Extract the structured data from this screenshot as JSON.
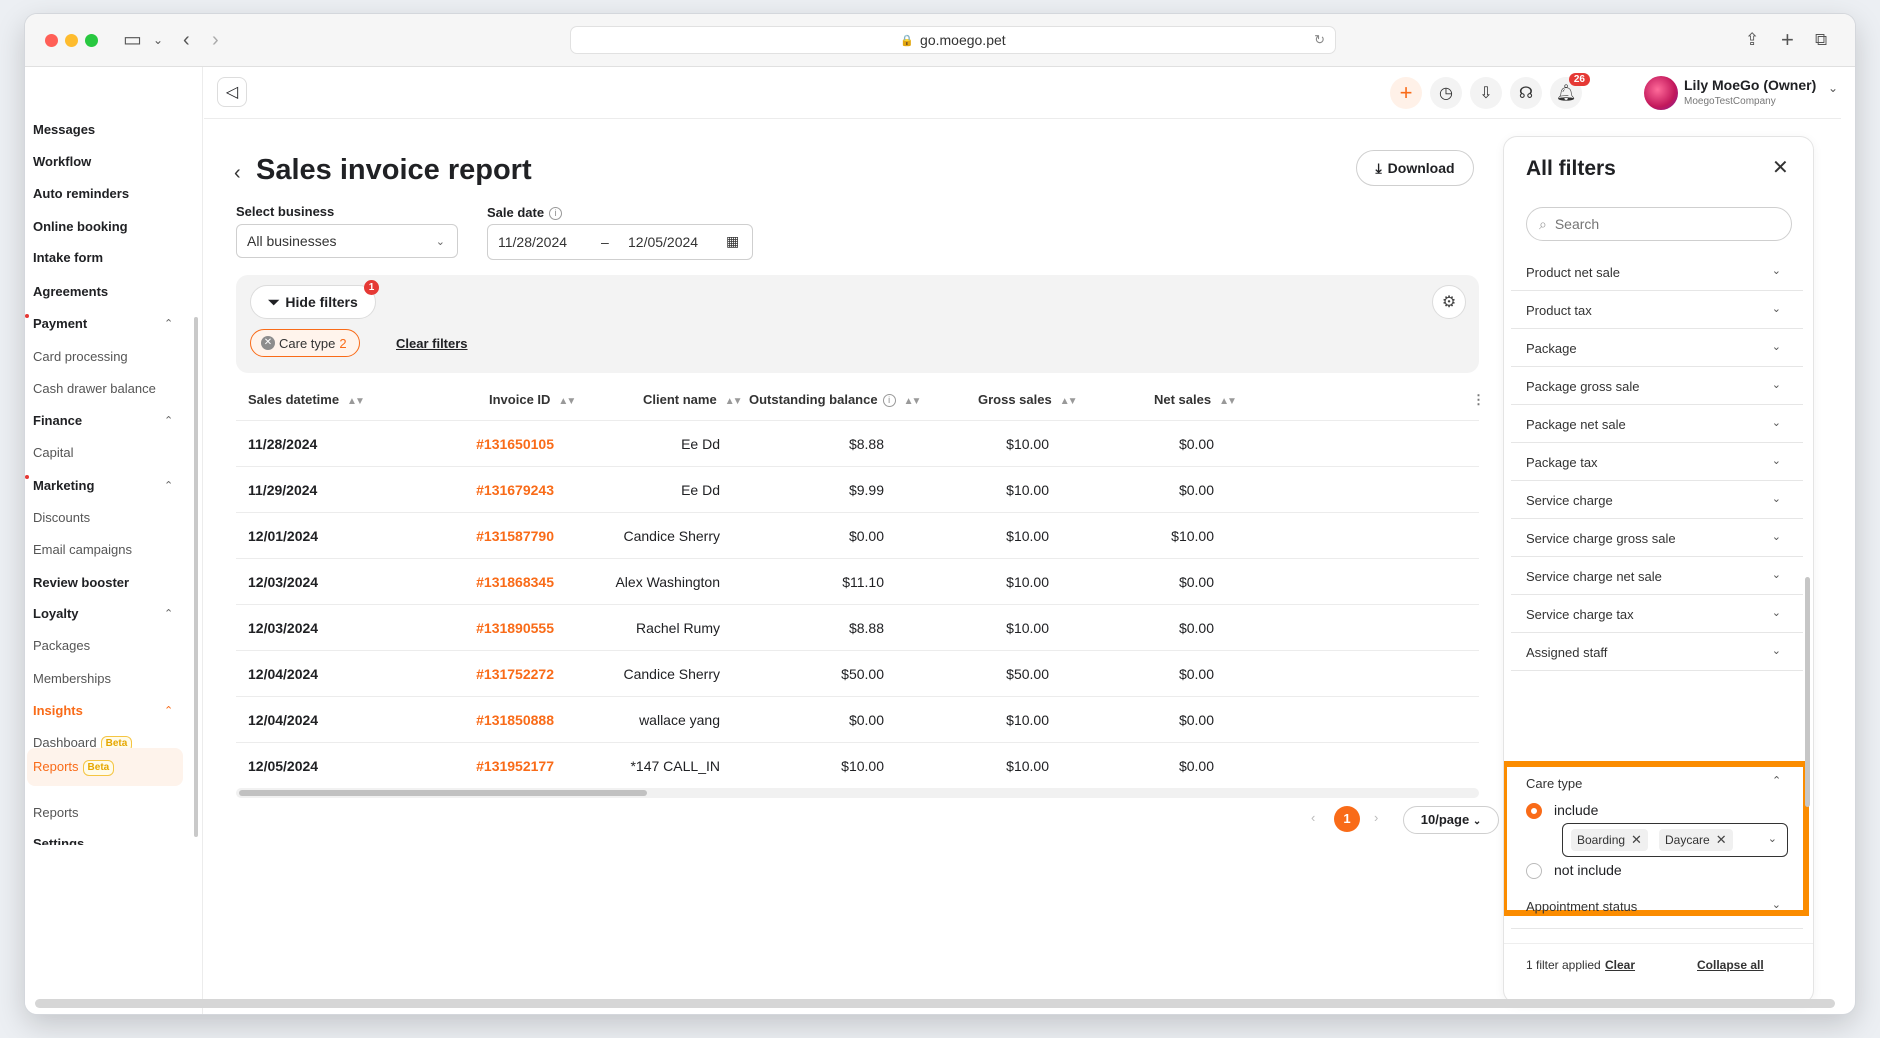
{
  "browser": {
    "url": "go.moego.pet"
  },
  "sidebar": {
    "items": [
      {
        "label": "Messages",
        "style": "bold"
      },
      {
        "label": "Workflow",
        "style": "bold"
      },
      {
        "label": "Auto reminders",
        "style": "bold"
      },
      {
        "label": "Online booking",
        "style": "bold"
      },
      {
        "label": "Intake form",
        "style": "bold"
      },
      {
        "label": "Agreements",
        "style": "bold"
      },
      {
        "label": "Payment",
        "style": "group"
      },
      {
        "label": "Card processing",
        "style": "sub"
      },
      {
        "label": "Cash drawer balance",
        "style": "sub"
      },
      {
        "label": "Finance",
        "style": "group"
      },
      {
        "label": "Capital",
        "style": "sub"
      },
      {
        "label": "Marketing",
        "style": "group"
      },
      {
        "label": "Discounts",
        "style": "sub"
      },
      {
        "label": "Email campaigns",
        "style": "sub"
      },
      {
        "label": "Review booster",
        "style": "bold"
      },
      {
        "label": "Loyalty",
        "style": "group"
      },
      {
        "label": "Packages",
        "style": "sub"
      },
      {
        "label": "Memberships",
        "style": "sub"
      },
      {
        "label": "Insights",
        "style": "active-group"
      },
      {
        "label": "Dashboard",
        "style": "sub",
        "badge": "Beta"
      },
      {
        "label": "Reports",
        "style": "active",
        "badge": "Beta"
      },
      {
        "label": "Reports",
        "style": "sub"
      },
      {
        "label": "Settings",
        "style": "bold"
      }
    ]
  },
  "header": {
    "notification_count": "26",
    "user_name": "Lily MoeGo (Owner)",
    "company": "MoegoTestCompany"
  },
  "page": {
    "title": "Sales invoice report",
    "download_label": "Download",
    "select_business_label": "Select business",
    "select_business_value": "All businesses",
    "sale_date_label": "Sale date",
    "date_from": "11/28/2024",
    "date_sep": "–",
    "date_to": "12/05/2024",
    "hide_filters_label": "Hide filters",
    "hide_filters_badge": "1",
    "chip_label": "Care type",
    "chip_count": "2",
    "clear_filters_label": "Clear filters"
  },
  "table": {
    "columns": [
      "Sales datetime",
      "Invoice ID",
      "Client name",
      "Outstanding balance",
      "Gross sales",
      "Net sales"
    ],
    "rows": [
      [
        "11/28/2024",
        "#131650105",
        "Ee Dd",
        "$8.88",
        "$10.00",
        "$0.00"
      ],
      [
        "11/29/2024",
        "#131679243",
        "Ee Dd",
        "$9.99",
        "$10.00",
        "$0.00"
      ],
      [
        "12/01/2024",
        "#131587790",
        "Candice Sherry",
        "$0.00",
        "$10.00",
        "$10.00"
      ],
      [
        "12/03/2024",
        "#131868345",
        "Alex Washington",
        "$11.10",
        "$10.00",
        "$0.00"
      ],
      [
        "12/03/2024",
        "#131890555",
        "Rachel Rumy",
        "$8.88",
        "$10.00",
        "$0.00"
      ],
      [
        "12/04/2024",
        "#131752272",
        "Candice Sherry",
        "$50.00",
        "$50.00",
        "$0.00"
      ],
      [
        "12/04/2024",
        "#131850888",
        "wallace yang",
        "$0.00",
        "$10.00",
        "$0.00"
      ],
      [
        "12/05/2024",
        "#131952177",
        "*147 CALL_IN",
        "$10.00",
        "$10.00",
        "$0.00"
      ]
    ]
  },
  "pagination": {
    "current": "1",
    "page_size": "10/page"
  },
  "filters_panel": {
    "title": "All filters",
    "search_placeholder": "Search",
    "items_before": [
      "Product net sale",
      "Product tax",
      "Package",
      "Package gross sale",
      "Package net sale",
      "Package tax",
      "Service charge",
      "Service charge gross sale",
      "Service charge net sale",
      "Service charge tax",
      "Assigned staff"
    ],
    "care_type": {
      "label": "Care type",
      "include_label": "include",
      "not_include_label": "not include",
      "selected_tags": [
        "Boarding",
        "Daycare"
      ]
    },
    "items_after": [
      "Appointment status"
    ],
    "footer_applied": "1 filter applied",
    "footer_clear": "Clear",
    "footer_collapse": "Collapse all"
  },
  "colors": {
    "accent": "#f96b18",
    "highlight_box": "#fb8c00"
  }
}
